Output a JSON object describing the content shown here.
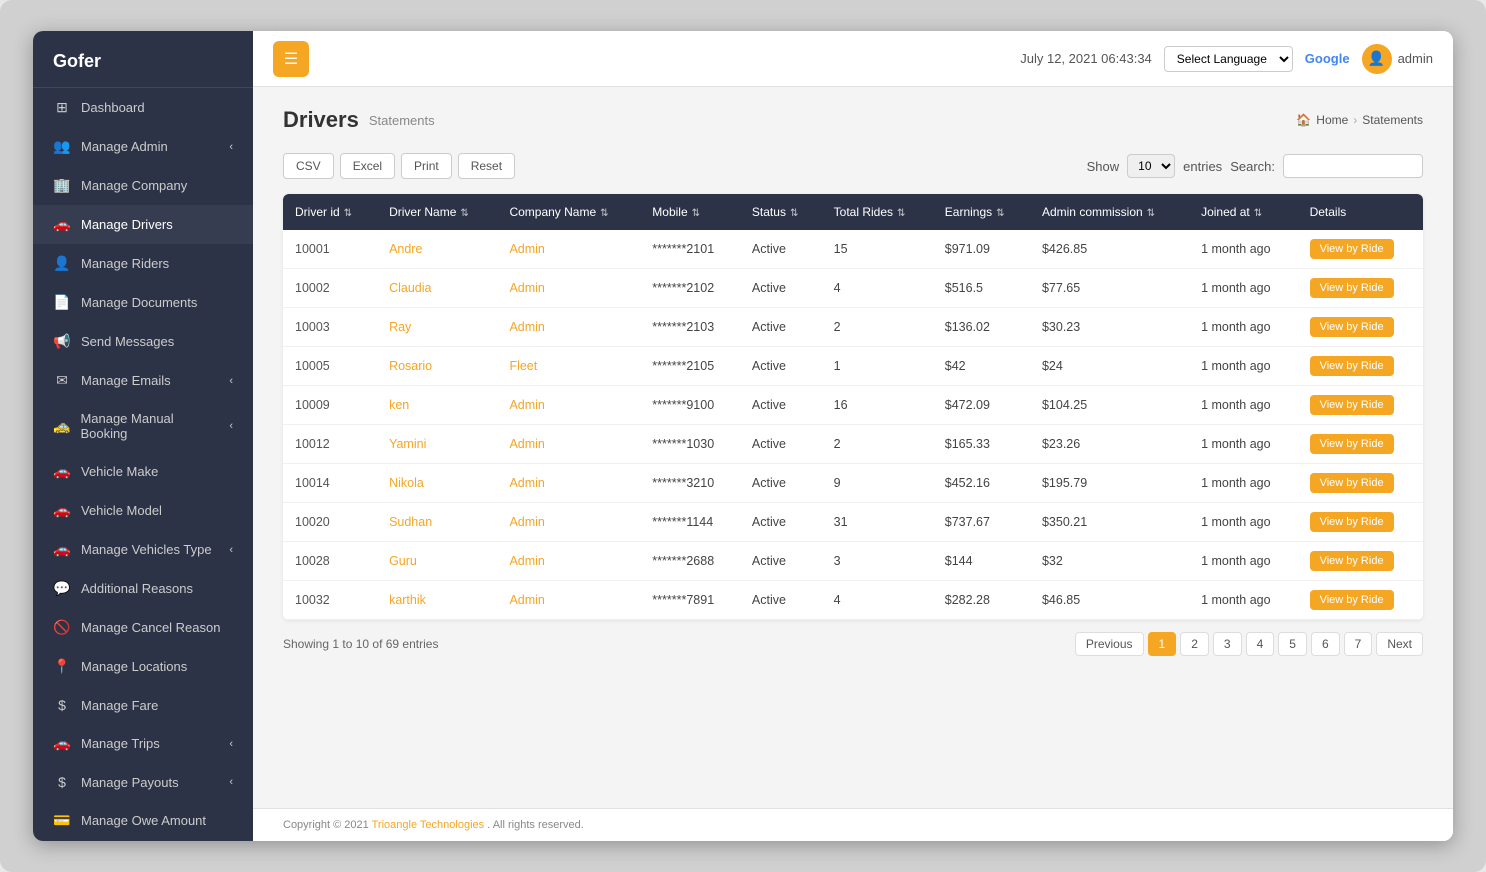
{
  "app": {
    "name": "Gofer"
  },
  "header": {
    "menu_icon": "☰",
    "datetime": "July 12, 2021 06:43:34",
    "lang_placeholder": "Select Language",
    "google_label": "Google",
    "admin_label": "admin",
    "avatar_icon": "👤"
  },
  "sidebar": {
    "items": [
      {
        "id": "dashboard",
        "icon": "⊞",
        "label": "Dashboard",
        "arrow": false
      },
      {
        "id": "manage-admin",
        "icon": "👥",
        "label": "Manage Admin",
        "arrow": true
      },
      {
        "id": "manage-company",
        "icon": "🏢",
        "label": "Manage Company",
        "arrow": false
      },
      {
        "id": "manage-drivers",
        "icon": "🚗",
        "label": "Manage Drivers",
        "arrow": false,
        "active": true
      },
      {
        "id": "manage-riders",
        "icon": "👤",
        "label": "Manage Riders",
        "arrow": false
      },
      {
        "id": "manage-documents",
        "icon": "📄",
        "label": "Manage Documents",
        "arrow": false
      },
      {
        "id": "send-messages",
        "icon": "📢",
        "label": "Send Messages",
        "arrow": false
      },
      {
        "id": "manage-emails",
        "icon": "✉",
        "label": "Manage Emails",
        "arrow": true
      },
      {
        "id": "manage-manual-booking",
        "icon": "🚕",
        "label": "Manage Manual Booking",
        "arrow": true
      },
      {
        "id": "vehicle-make",
        "icon": "🚗",
        "label": "Vehicle Make",
        "arrow": false
      },
      {
        "id": "vehicle-model",
        "icon": "🚗",
        "label": "Vehicle Model",
        "arrow": false
      },
      {
        "id": "manage-vehicles-type",
        "icon": "🚗",
        "label": "Manage Vehicles Type",
        "arrow": true
      },
      {
        "id": "additional-reasons",
        "icon": "💬",
        "label": "Additional Reasons",
        "arrow": false
      },
      {
        "id": "manage-cancel-reason",
        "icon": "🚫",
        "label": "Manage Cancel Reason",
        "arrow": false
      },
      {
        "id": "manage-locations",
        "icon": "📍",
        "label": "Manage Locations",
        "arrow": false
      },
      {
        "id": "manage-fare",
        "icon": "$",
        "label": "Manage Fare",
        "arrow": false
      },
      {
        "id": "manage-trips",
        "icon": "🚗",
        "label": "Manage Trips",
        "arrow": true
      },
      {
        "id": "manage-payouts",
        "icon": "$",
        "label": "Manage Payouts",
        "arrow": true
      },
      {
        "id": "manage-owe-amount",
        "icon": "💳",
        "label": "Manage Owe Amount",
        "arrow": false
      }
    ]
  },
  "page": {
    "title": "Drivers",
    "subtitle": "Statements",
    "breadcrumb_home": "Home",
    "breadcrumb_current": "Statements"
  },
  "controls": {
    "csv_label": "CSV",
    "excel_label": "Excel",
    "print_label": "Print",
    "reset_label": "Reset",
    "show_label": "Show",
    "entries_label": "entries",
    "search_label": "Search:",
    "entries_value": "10"
  },
  "table": {
    "columns": [
      {
        "key": "driver_id",
        "label": "Driver id"
      },
      {
        "key": "driver_name",
        "label": "Driver Name"
      },
      {
        "key": "company_name",
        "label": "Company Name"
      },
      {
        "key": "mobile",
        "label": "Mobile"
      },
      {
        "key": "status",
        "label": "Status"
      },
      {
        "key": "total_rides",
        "label": "Total Rides"
      },
      {
        "key": "earnings",
        "label": "Earnings"
      },
      {
        "key": "admin_commission",
        "label": "Admin commission"
      },
      {
        "key": "joined_at",
        "label": "Joined at"
      },
      {
        "key": "details",
        "label": "Details"
      }
    ],
    "rows": [
      {
        "driver_id": "10001",
        "driver_name": "Andre",
        "company_name": "Admin",
        "mobile": "*******2101",
        "status": "Active",
        "total_rides": "15",
        "earnings": "$971.09",
        "admin_commission": "$426.85",
        "joined_at": "1 month ago",
        "btn": "View by Ride"
      },
      {
        "driver_id": "10002",
        "driver_name": "Claudia",
        "company_name": "Admin",
        "mobile": "*******2102",
        "status": "Active",
        "total_rides": "4",
        "earnings": "$516.5",
        "admin_commission": "$77.65",
        "joined_at": "1 month ago",
        "btn": "View by Ride"
      },
      {
        "driver_id": "10003",
        "driver_name": "Ray",
        "company_name": "Admin",
        "mobile": "*******2103",
        "status": "Active",
        "total_rides": "2",
        "earnings": "$136.02",
        "admin_commission": "$30.23",
        "joined_at": "1 month ago",
        "btn": "View by Ride"
      },
      {
        "driver_id": "10005",
        "driver_name": "Rosario",
        "company_name": "Fleet",
        "mobile": "*******2105",
        "status": "Active",
        "total_rides": "1",
        "earnings": "$42",
        "admin_commission": "$24",
        "joined_at": "1 month ago",
        "btn": "View by Ride"
      },
      {
        "driver_id": "10009",
        "driver_name": "ken",
        "company_name": "Admin",
        "mobile": "*******9100",
        "status": "Active",
        "total_rides": "16",
        "earnings": "$472.09",
        "admin_commission": "$104.25",
        "joined_at": "1 month ago",
        "btn": "View by Ride"
      },
      {
        "driver_id": "10012",
        "driver_name": "Yamini",
        "company_name": "Admin",
        "mobile": "*******1030",
        "status": "Active",
        "total_rides": "2",
        "earnings": "$165.33",
        "admin_commission": "$23.26",
        "joined_at": "1 month ago",
        "btn": "View by Ride"
      },
      {
        "driver_id": "10014",
        "driver_name": "Nikola",
        "company_name": "Admin",
        "mobile": "*******3210",
        "status": "Active",
        "total_rides": "9",
        "earnings": "$452.16",
        "admin_commission": "$195.79",
        "joined_at": "1 month ago",
        "btn": "View by Ride"
      },
      {
        "driver_id": "10020",
        "driver_name": "Sudhan",
        "company_name": "Admin",
        "mobile": "*******1144",
        "status": "Active",
        "total_rides": "31",
        "earnings": "$737.67",
        "admin_commission": "$350.21",
        "joined_at": "1 month ago",
        "btn": "View by Ride"
      },
      {
        "driver_id": "10028",
        "driver_name": "Guru",
        "company_name": "Admin",
        "mobile": "*******2688",
        "status": "Active",
        "total_rides": "3",
        "earnings": "$144",
        "admin_commission": "$32",
        "joined_at": "1 month ago",
        "btn": "View by Ride"
      },
      {
        "driver_id": "10032",
        "driver_name": "karthik",
        "company_name": "Admin",
        "mobile": "*******7891",
        "status": "Active",
        "total_rides": "4",
        "earnings": "$282.28",
        "admin_commission": "$46.85",
        "joined_at": "1 month ago",
        "btn": "View by Ride"
      }
    ]
  },
  "pagination": {
    "showing_text": "Showing 1 to 10 of 69 entries",
    "previous_label": "Previous",
    "next_label": "Next",
    "pages": [
      "1",
      "2",
      "3",
      "4",
      "5",
      "6",
      "7"
    ],
    "active_page": "1"
  },
  "footer": {
    "text": "Copyright © 2021",
    "company": "Trioangle Technologies",
    "rights": ". All rights reserved."
  }
}
